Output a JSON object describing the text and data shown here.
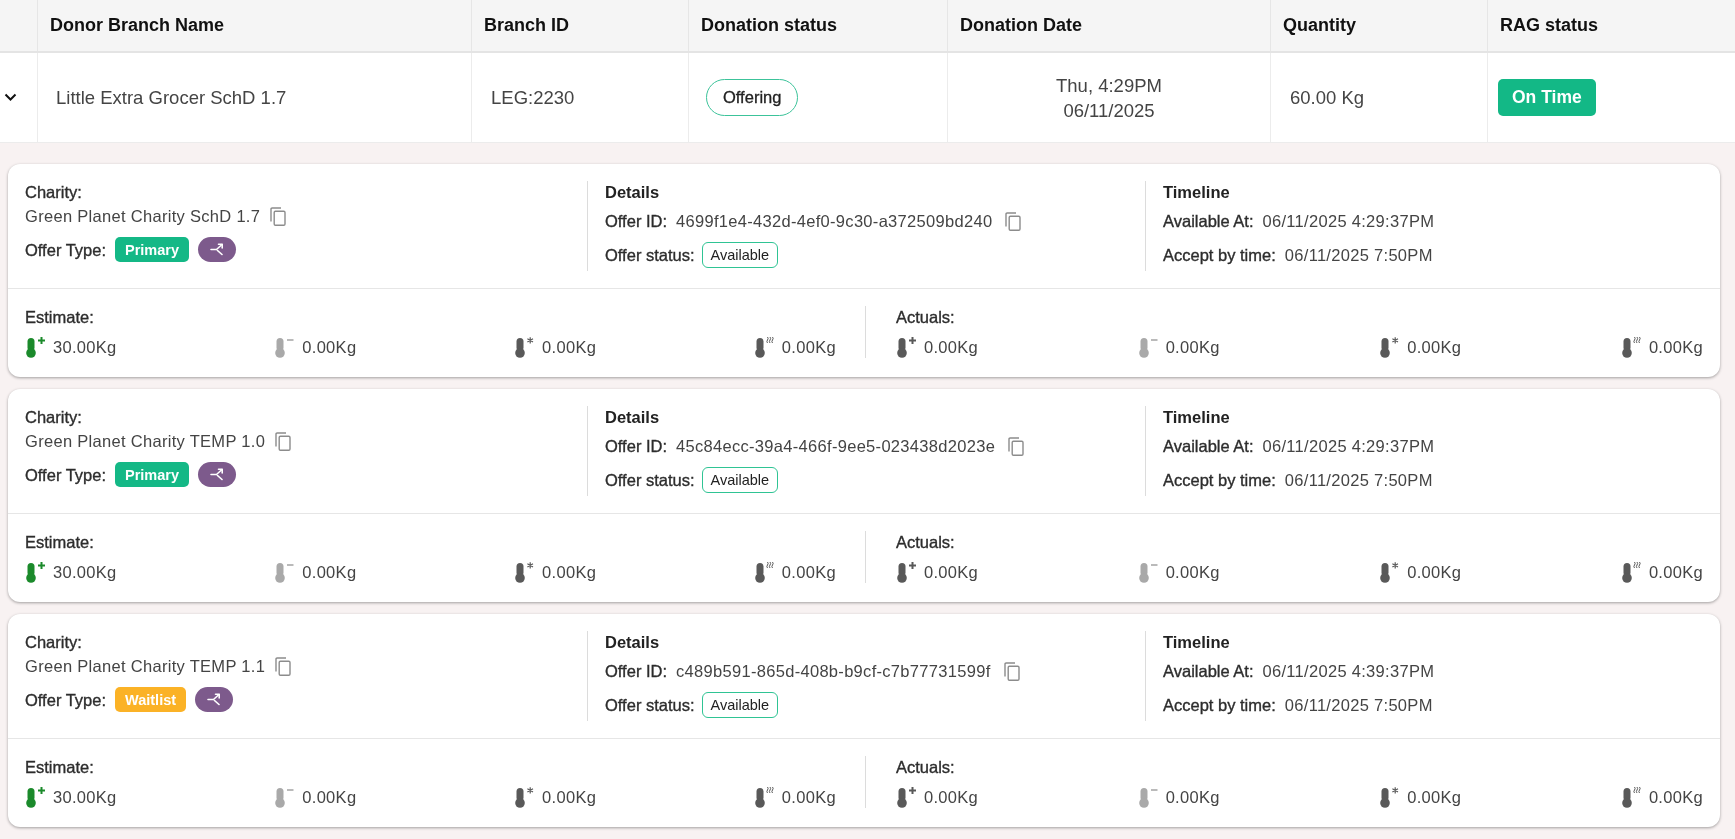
{
  "table": {
    "columns": [
      {
        "label": "Donor Branch Name"
      },
      {
        "label": "Branch ID"
      },
      {
        "label": "Donation status"
      },
      {
        "label": "Donation Date"
      },
      {
        "label": "Quantity"
      },
      {
        "label": "RAG status"
      }
    ],
    "rows": [
      {
        "expanded": true,
        "donor_branch_name": "Little Extra Grocer SchD 1.7",
        "branch_id": "LEG:2230",
        "donation_status": "Offering",
        "donation_date": {
          "day_time": "Thu, 4:29PM",
          "date": "06/11/2025"
        },
        "quantity": "60.00 Kg",
        "rag_status": {
          "text": "On Time",
          "kind": "green"
        },
        "offers": [
          {
            "charity": {
              "label": "Charity:",
              "value": "Green Planet Charity SchD 1.7"
            },
            "offer_type": {
              "label": "Offer Type:",
              "value": "Primary",
              "color": "#14b886"
            },
            "details": {
              "title": "Details",
              "offer_id": {
                "label": "Offer ID:",
                "value": "4699f1e4-432d-4ef0-9c30-a372509bd240"
              },
              "offer_status": {
                "label": "Offer status:",
                "value": "Available"
              }
            },
            "timeline": {
              "title": "Timeline",
              "available_at": {
                "label": "Available At:",
                "value": "06/11/2025 4:29:37PM"
              },
              "accept_by": {
                "label": "Accept by time:",
                "value": "06/11/2025 7:50PM"
              }
            },
            "estimate": {
              "label": "Estimate:",
              "items": [
                {
                  "kind": "ambient",
                  "color": "#1b8a2b",
                  "value": "30.00Kg"
                },
                {
                  "kind": "chilled",
                  "color": "#a9a9a9",
                  "value": "0.00Kg"
                },
                {
                  "kind": "frozen",
                  "color": "#595959",
                  "value": "0.00Kg"
                },
                {
                  "kind": "hot",
                  "color": "#595959",
                  "value": "0.00Kg"
                }
              ]
            },
            "actuals": {
              "label": "Actuals:",
              "items": [
                {
                  "kind": "ambient",
                  "color": "#595959",
                  "value": "0.00Kg"
                },
                {
                  "kind": "chilled",
                  "color": "#a9a9a9",
                  "value": "0.00Kg"
                },
                {
                  "kind": "frozen",
                  "color": "#595959",
                  "value": "0.00Kg"
                },
                {
                  "kind": "hot",
                  "color": "#595959",
                  "value": "0.00Kg"
                }
              ]
            }
          },
          {
            "charity": {
              "label": "Charity:",
              "value": "Green Planet Charity TEMP 1.0"
            },
            "offer_type": {
              "label": "Offer Type:",
              "value": "Primary",
              "color": "#14b886"
            },
            "details": {
              "title": "Details",
              "offer_id": {
                "label": "Offer ID:",
                "value": "45c84ecc-39a4-466f-9ee5-023438d2023e"
              },
              "offer_status": {
                "label": "Offer status:",
                "value": "Available"
              }
            },
            "timeline": {
              "title": "Timeline",
              "available_at": {
                "label": "Available At:",
                "value": "06/11/2025 4:29:37PM"
              },
              "accept_by": {
                "label": "Accept by time:",
                "value": "06/11/2025 7:50PM"
              }
            },
            "estimate": {
              "label": "Estimate:",
              "items": [
                {
                  "kind": "ambient",
                  "color": "#1b8a2b",
                  "value": "30.00Kg"
                },
                {
                  "kind": "chilled",
                  "color": "#a9a9a9",
                  "value": "0.00Kg"
                },
                {
                  "kind": "frozen",
                  "color": "#595959",
                  "value": "0.00Kg"
                },
                {
                  "kind": "hot",
                  "color": "#595959",
                  "value": "0.00Kg"
                }
              ]
            },
            "actuals": {
              "label": "Actuals:",
              "items": [
                {
                  "kind": "ambient",
                  "color": "#595959",
                  "value": "0.00Kg"
                },
                {
                  "kind": "chilled",
                  "color": "#a9a9a9",
                  "value": "0.00Kg"
                },
                {
                  "kind": "frozen",
                  "color": "#595959",
                  "value": "0.00Kg"
                },
                {
                  "kind": "hot",
                  "color": "#595959",
                  "value": "0.00Kg"
                }
              ]
            }
          },
          {
            "charity": {
              "label": "Charity:",
              "value": "Green Planet Charity TEMP 1.1"
            },
            "offer_type": {
              "label": "Offer Type:",
              "value": "Waitlist",
              "color": "#fbb226"
            },
            "details": {
              "title": "Details",
              "offer_id": {
                "label": "Offer ID:",
                "value": "c489b591-865d-408b-b9cf-c7b77731599f"
              },
              "offer_status": {
                "label": "Offer status:",
                "value": "Available"
              }
            },
            "timeline": {
              "title": "Timeline",
              "available_at": {
                "label": "Available At:",
                "value": "06/11/2025 4:39:37PM"
              },
              "accept_by": {
                "label": "Accept by time:",
                "value": "06/11/2025 7:50PM"
              }
            },
            "estimate": {
              "label": "Estimate:",
              "items": [
                {
                  "kind": "ambient",
                  "color": "#1b8a2b",
                  "value": "30.00Kg"
                },
                {
                  "kind": "chilled",
                  "color": "#a9a9a9",
                  "value": "0.00Kg"
                },
                {
                  "kind": "frozen",
                  "color": "#595959",
                  "value": "0.00Kg"
                },
                {
                  "kind": "hot",
                  "color": "#595959",
                  "value": "0.00Kg"
                }
              ]
            },
            "actuals": {
              "label": "Actuals:",
              "items": [
                {
                  "kind": "ambient",
                  "color": "#595959",
                  "value": "0.00Kg"
                },
                {
                  "kind": "chilled",
                  "color": "#a9a9a9",
                  "value": "0.00Kg"
                },
                {
                  "kind": "frozen",
                  "color": "#595959",
                  "value": "0.00Kg"
                },
                {
                  "kind": "hot",
                  "color": "#595959",
                  "value": "0.00Kg"
                }
              ]
            }
          }
        ]
      }
    ]
  }
}
